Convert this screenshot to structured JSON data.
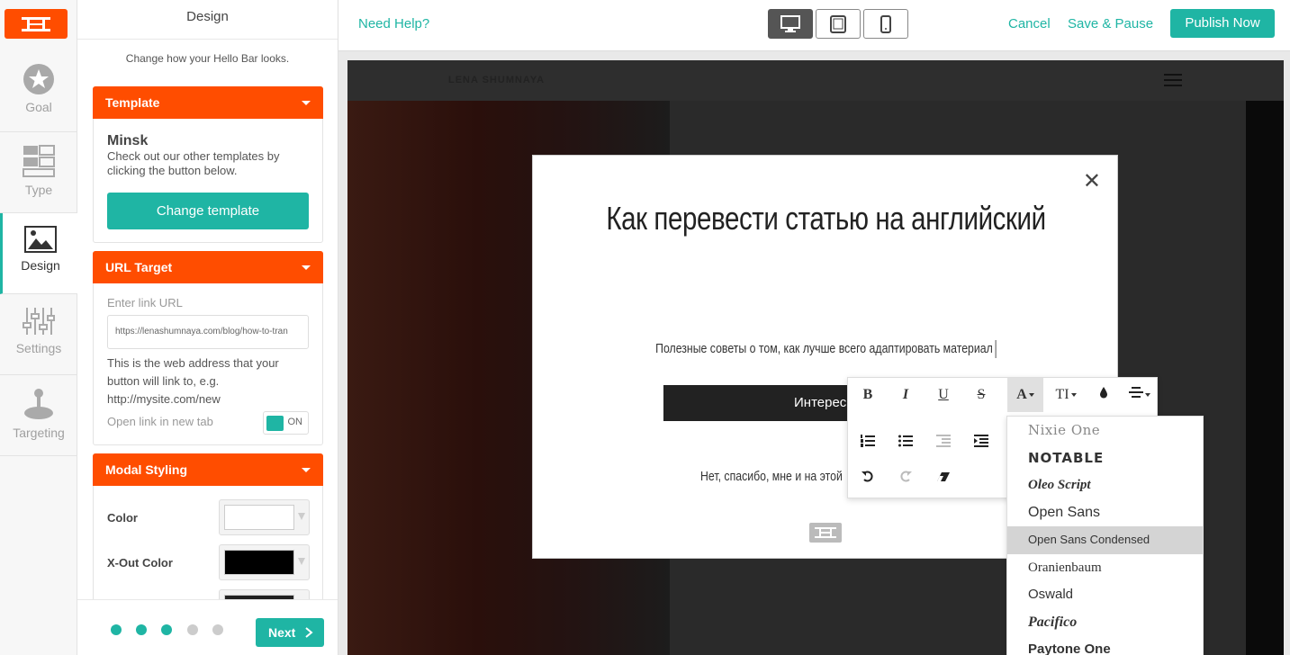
{
  "rail": {
    "items": [
      {
        "label": "Goal",
        "icon": "star-icon"
      },
      {
        "label": "Type",
        "icon": "layout-icon"
      },
      {
        "label": "Design",
        "icon": "image-icon"
      },
      {
        "label": "Settings",
        "icon": "sliders-icon"
      },
      {
        "label": "Targeting",
        "icon": "joystick-icon"
      }
    ]
  },
  "panel": {
    "title": "Design",
    "subtitle": "Change how your Hello Bar looks.",
    "template_card": {
      "header": "Template",
      "name": "Minsk",
      "description": "Check out our other templates by clicking the button below.",
      "button": "Change template"
    },
    "url_card": {
      "header": "URL Target",
      "placeholder_label": "Enter link URL",
      "url_value": "https://lenashumnaya.com/blog/how-to-tran",
      "help": "This is the web address that your button will link to, e.g. http://mysite.com/new",
      "new_tab_label": "Open link in new tab",
      "toggle_text": "ON"
    },
    "modal_card": {
      "header": "Modal Styling",
      "color_label": "Color",
      "xout_label": "X-Out Color",
      "color_value": "#ffffff",
      "xout_value": "#000000"
    },
    "footer": {
      "next": "Next",
      "steps_total": 5,
      "steps_done": 3
    }
  },
  "topbar": {
    "help": "Need Help?",
    "cancel": "Cancel",
    "save_pause": "Save & Pause",
    "publish": "Publish Now"
  },
  "site": {
    "brand": "LENA SHUMNAYA"
  },
  "modal": {
    "headline": "Как перевести статью на английский",
    "subtitle": "Полезные советы о том, как лучше всего адаптировать материал",
    "cta": "Интересно",
    "decline": "Нет, спасибо, мне и на этой"
  },
  "toolbar": {
    "bold": "B",
    "italic": "I",
    "underline": "U",
    "strike": "S",
    "font": "A",
    "size": "TI"
  },
  "font_menu": {
    "options": [
      "Nixie One",
      "NOTABLE",
      "Oleo Script",
      "Open Sans",
      "Open Sans Condensed",
      "Oranienbaum",
      "Oswald",
      "Pacifico",
      "Paytone One"
    ],
    "highlighted": "Open Sans Condensed"
  },
  "colors": {
    "accent": "#1fb5a4",
    "brand": "#ff4d00"
  }
}
